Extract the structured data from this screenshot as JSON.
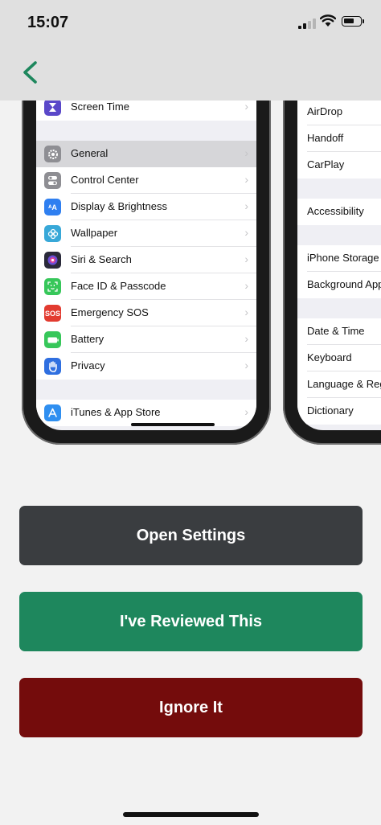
{
  "status_bar": {
    "time": "15:07"
  },
  "nav": {
    "back_icon": "chevron-left-icon",
    "accent_color": "#1e875d"
  },
  "phone_left_rows": [
    {
      "label": "Screen Time",
      "icon": "hourglass-icon",
      "color": "#5a48c9"
    },
    {
      "label": "General",
      "icon": "gear-icon",
      "color": "#8e8e93",
      "selected": true
    },
    {
      "label": "Control Center",
      "icon": "toggles-icon",
      "color": "#8e8e93"
    },
    {
      "label": "Display & Brightness",
      "icon": "text-size-icon",
      "color": "#2f7ff0"
    },
    {
      "label": "Wallpaper",
      "icon": "flower-icon",
      "color": "#38a8d8"
    },
    {
      "label": "Siri & Search",
      "icon": "siri-icon",
      "color": "#2a2a3a"
    },
    {
      "label": "Face ID & Passcode",
      "icon": "face-id-icon",
      "color": "#37c75a"
    },
    {
      "label": "Emergency SOS",
      "icon": "sos-icon",
      "color": "#e23b30",
      "badge": "SOS"
    },
    {
      "label": "Battery",
      "icon": "battery-icon",
      "color": "#37c75a"
    },
    {
      "label": "Privacy",
      "icon": "hand-icon",
      "color": "#2f6fe0"
    },
    {
      "label": "iTunes & App Store",
      "icon": "app-store-icon",
      "color": "#2f8ff0"
    }
  ],
  "phone_right_rows": [
    {
      "label": "AirDrop"
    },
    {
      "label": "Handoff"
    },
    {
      "label": "CarPlay"
    },
    {
      "label": "Accessibility"
    },
    {
      "label": "iPhone Storage"
    },
    {
      "label": "Background App"
    },
    {
      "label": "Date & Time"
    },
    {
      "label": "Keyboard"
    },
    {
      "label": "Language & Reg"
    },
    {
      "label": "Dictionary"
    }
  ],
  "actions": {
    "open_settings": "Open Settings",
    "reviewed": "I've Reviewed This",
    "ignore": "Ignore It"
  }
}
